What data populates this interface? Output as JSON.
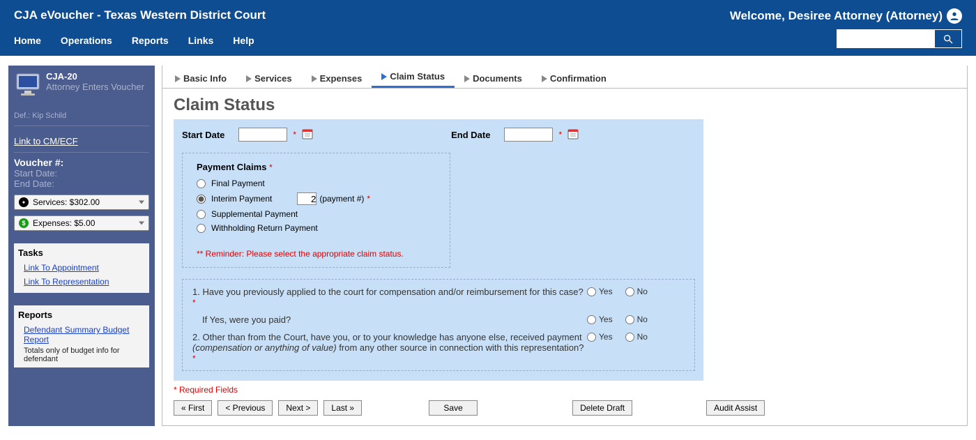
{
  "header": {
    "title": "CJA eVoucher - Texas Western District Court",
    "welcome": "Welcome, Desiree Attorney (Attorney)",
    "nav": {
      "home": "Home",
      "operations": "Operations",
      "reports": "Reports",
      "links": "Links",
      "help": "Help"
    }
  },
  "sidebar": {
    "code": "CJA-20",
    "role": "Attorney Enters Voucher",
    "defendant_label": "Def.: Kip Schild",
    "cmecf_link": "Link to CM/ECF",
    "voucher_header": "Voucher #:",
    "start_label": "Start Date:",
    "end_label": "End Date:",
    "services_pill": "Services: $302.00",
    "expenses_pill": "Expenses: $5.00",
    "tasks": {
      "heading": "Tasks",
      "link1": "Link To Appointment",
      "link2": "Link To Representation"
    },
    "reports": {
      "heading": "Reports",
      "link": "Defendant Summary Budget Report",
      "note": "Totals only of budget info for defendant"
    }
  },
  "tabs": {
    "basic": "Basic Info",
    "services": "Services",
    "expenses": "Expenses",
    "claim": "Claim Status",
    "documents": "Documents",
    "confirmation": "Confirmation"
  },
  "claim": {
    "heading": "Claim Status",
    "start_date_label": "Start Date",
    "end_date_label": "End Date",
    "payment_claims_label": "Payment Claims",
    "options": {
      "final": "Final Payment",
      "interim": "Interim Payment",
      "supplemental": "Supplemental Payment",
      "withholding": "Withholding Return Payment"
    },
    "interim_number": "2",
    "payment_number_label": "(payment #)",
    "reminder": "** Reminder: Please select the appropriate claim status.",
    "yes": "Yes",
    "no": "No",
    "q1": "1. Have you previously applied to the court for compensation and/or reimbursement for this case?",
    "q1b": "If Yes, were you paid?",
    "q2a": "2. Other than from the Court, have you, or to your knowledge has anyone else, received payment",
    "q2i": "(compensation or anything of value)",
    "q2b": " from any other source in connection with this representation?",
    "required_legend": "* Required Fields"
  },
  "buttons": {
    "first": "« First",
    "prev": "< Previous",
    "next": "Next >",
    "last": "Last »",
    "save": "Save",
    "delete": "Delete Draft",
    "audit": "Audit Assist"
  }
}
